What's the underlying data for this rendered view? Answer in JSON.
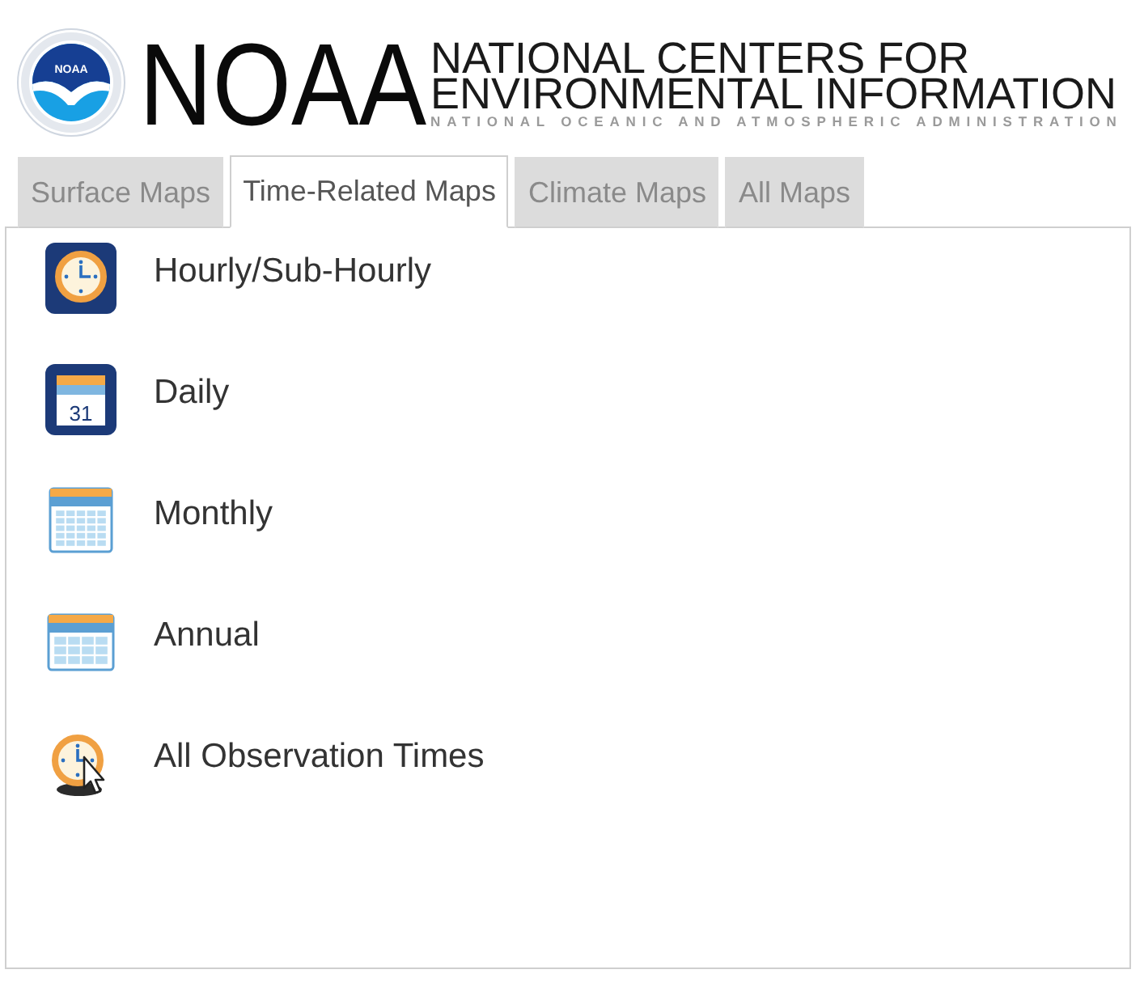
{
  "header": {
    "emblem_text": "NOAA",
    "wordmark": "NOAA",
    "title_lines": [
      "NATIONAL CENTERS FOR",
      "ENVIRONMENTAL INFORMATION"
    ],
    "subtitle": "NATIONAL OCEANIC AND ATMOSPHERIC ADMINISTRATION"
  },
  "tabs": [
    {
      "label": "Surface Maps",
      "selected": false
    },
    {
      "label": "Time-Related Maps",
      "selected": true
    },
    {
      "label": "Climate Maps",
      "selected": false
    },
    {
      "label": "All Maps",
      "selected": false
    }
  ],
  "items": [
    {
      "kind": "clock",
      "label": "Hourly/Sub-Hourly"
    },
    {
      "kind": "day",
      "label": "Daily",
      "icon_text": "31"
    },
    {
      "kind": "month",
      "label": "Monthly"
    },
    {
      "kind": "year",
      "label": "Annual"
    },
    {
      "kind": "pointer",
      "label": "All Observation Times"
    }
  ]
}
